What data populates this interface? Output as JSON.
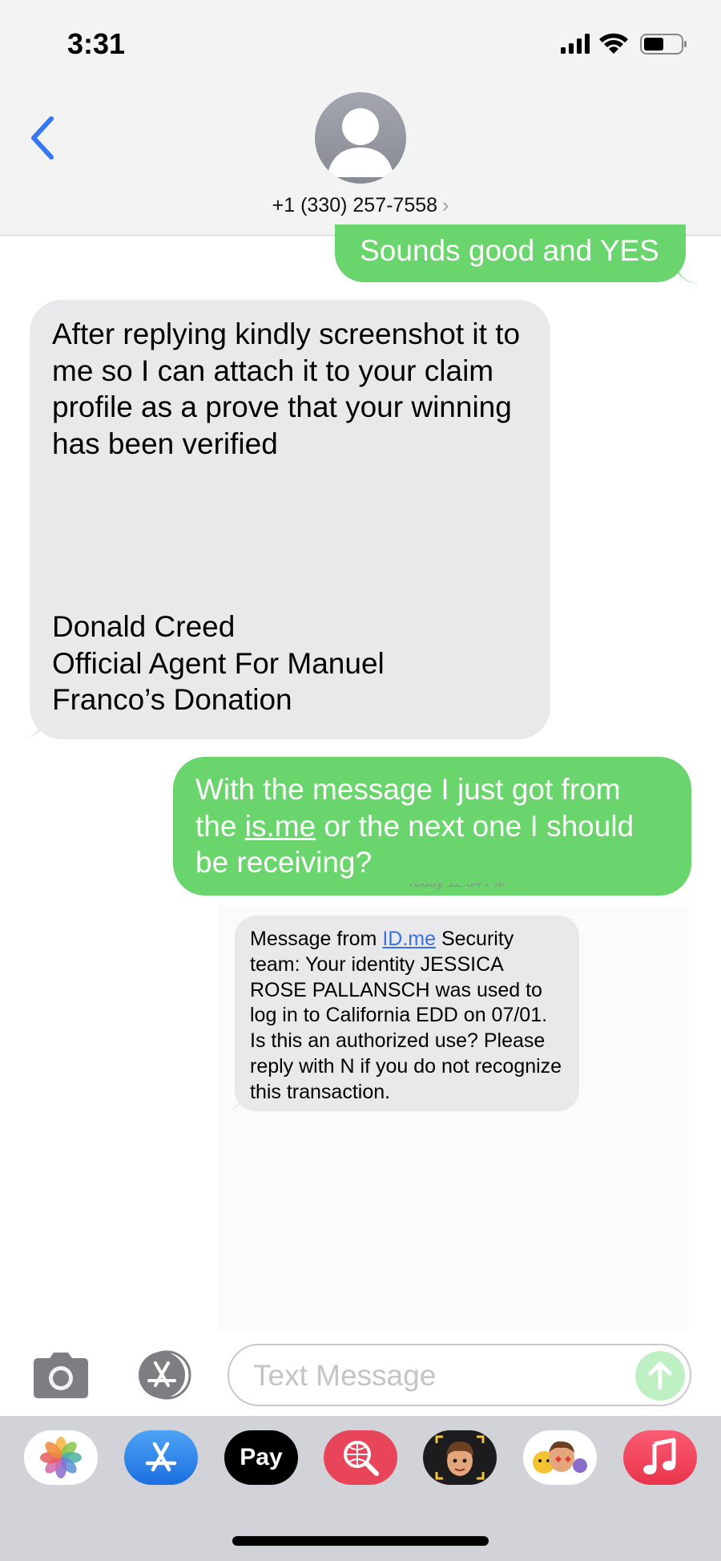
{
  "status_bar": {
    "time": "3:31"
  },
  "header": {
    "contact": "+1 (330) 257-7558",
    "chevron": "›"
  },
  "messages": {
    "m1": "Sounds good and YES",
    "m2_p1": "After replying kindly screenshot it to me so I can attach it to your claim profile as a prove that your winning has been verified",
    "m2_p2a": "Donald Creed",
    "m2_p2b": "Official Agent For Manuel",
    "m2_p2c": "Franco’s Donation",
    "m3_pre": "With the message I just got from the ",
    "m3_link": "is.me",
    "m3_post": " or the next one I should be receiving?",
    "timestamp": "Today 12:34 PM",
    "m4_pre": "Message from ",
    "m4_link": "ID.me",
    "m4_post": " Security team: Your identity JESSICA ROSE PALLANSCH was used to log in to California EDD on 07/01. Is this an authorized use? Please reply with N if you do not recognize this transaction."
  },
  "composer": {
    "placeholder": "Text Message"
  },
  "colors": {
    "outgoing": "#6ad56c",
    "incoming": "#e9e9eb",
    "link": "#3a70e0",
    "accent": "#3478f6"
  },
  "icons": [
    "back-chevron-icon",
    "avatar-icon",
    "camera-icon",
    "app-store-icon",
    "send-arrow-icon",
    "photos-icon",
    "apple-pay-icon",
    "search-images-icon",
    "memoji-icon",
    "animoji-stickers-icon",
    "music-icon"
  ],
  "app_drawer": {
    "apple_pay": " Pay"
  }
}
